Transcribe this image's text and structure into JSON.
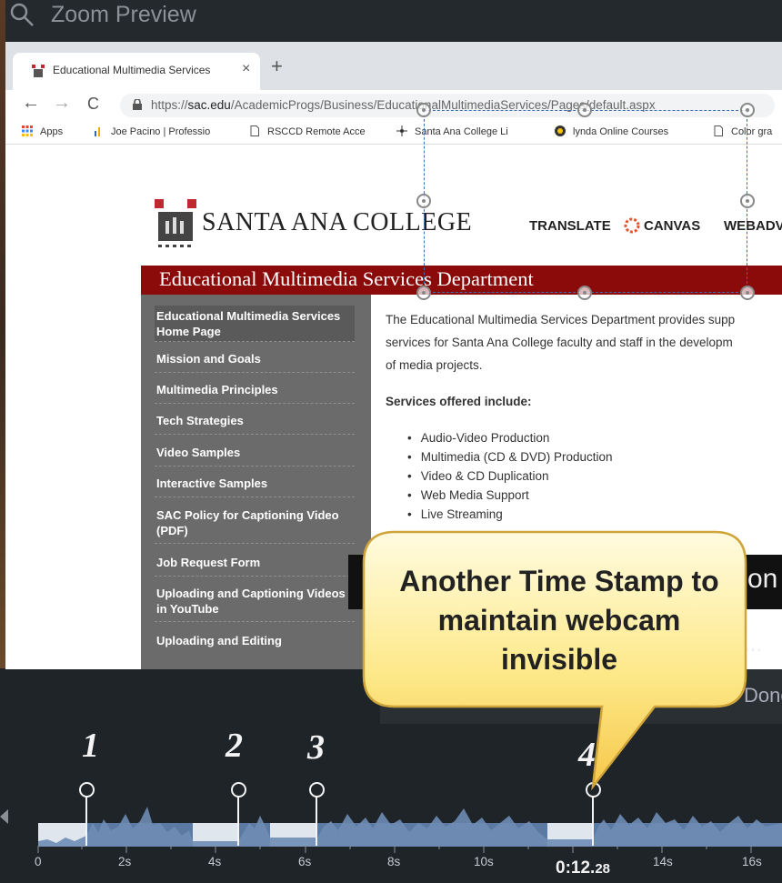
{
  "zoom_preview": {
    "title": "Zoom Preview"
  },
  "browser": {
    "tab": {
      "title": "Educational Multimedia Services",
      "close": "×"
    },
    "new_tab": "+",
    "nav": {
      "back": "←",
      "forward": "→",
      "reload": "C"
    },
    "url": {
      "prefix": "https://",
      "domain": "sac.edu",
      "path": "/AcademicProgs/Business/EducationalMultimediaServices/Pages/default.aspx"
    },
    "bookmarks": [
      {
        "label": "Apps",
        "icon": "apps-grid-icon"
      },
      {
        "label": "Joe Pacino | Professio",
        "icon": "bookmark-bar-chart-icon"
      },
      {
        "label": "RSCCD Remote Acce",
        "icon": "page-icon"
      },
      {
        "label": "Santa Ana College Li",
        "icon": "network-icon"
      },
      {
        "label": "lynda Online Courses",
        "icon": "lynda-icon"
      },
      {
        "label": "Color gra",
        "icon": "page-icon"
      }
    ]
  },
  "site": {
    "college_name": "SANTA ANA COLLEGE",
    "topnav": {
      "translate": "TRANSLATE",
      "canvas": "CANVAS",
      "webadv": "WEBADV"
    },
    "department_title": "Educational Multimedia Services Department",
    "sidenav": [
      "Educational Multimedia Services Home Page",
      "Mission and Goals",
      "Multimedia Principles",
      "Tech Strategies",
      "Video Samples",
      "Interactive Samples",
      "SAC Policy for Captioning Video (PDF)",
      "Job Request Form",
      "Uploading and Captioning Videos in YouTube",
      "Uploading and Editing"
    ],
    "intro_lines": [
      "The Educational Multimedia Services Department provides supp",
      "services for Santa Ana College faculty and staff in the developm",
      "of media projects."
    ],
    "services_heading": "Services offered include:",
    "services": [
      "Audio-Video Production",
      "Multimedia (CD & DVD) Production",
      "Video & CD Duplication",
      "Web Media Support",
      "Live Streaming"
    ]
  },
  "overlay": {
    "partial_text": "on",
    "dots": "...",
    "done": "Done"
  },
  "callout": {
    "text": "Another Time Stamp to maintain webcam invisible"
  },
  "timeline": {
    "markers": [
      "1",
      "2",
      "3",
      "4"
    ],
    "tick_labels": [
      "0",
      "2s",
      "4s",
      "6s",
      "8s",
      "10s",
      "14s",
      "16s"
    ],
    "current_time": {
      "main": "0:12.",
      "fraction": "28"
    },
    "colors": {
      "track": "#5b7aa3",
      "selected_segment": "#dfe6ee",
      "background": "#1f2428"
    }
  }
}
